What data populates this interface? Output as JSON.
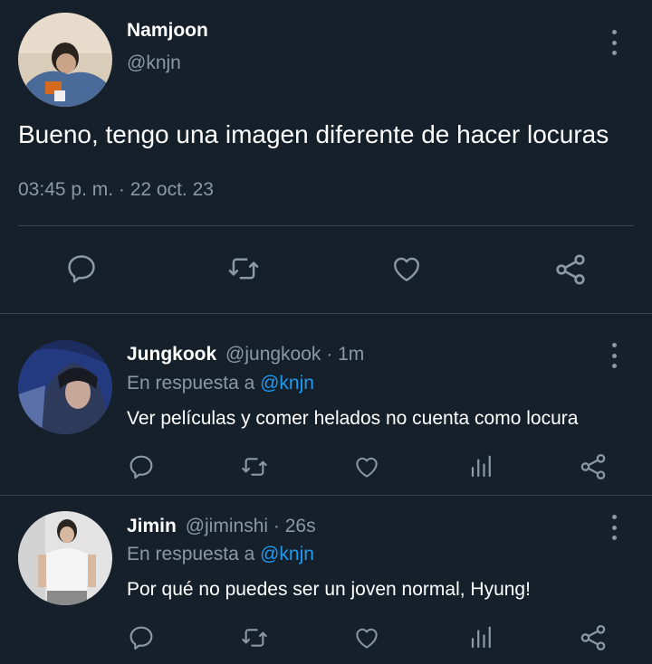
{
  "main_tweet": {
    "author_name": "Namjoon",
    "handle": "@knjn",
    "text": "Bueno, tengo una imagen diferente de hacer locuras",
    "timestamp": "03:45 p. m. · 22 oct. 23",
    "actions": [
      "reply-icon",
      "retweet-icon",
      "like-icon",
      "share-icon"
    ]
  },
  "replies": [
    {
      "author_name": "Jungkook",
      "handle": "@jungkook",
      "time": "· 1m",
      "reply_prefix": "En respuesta a",
      "reply_to": "@knjn",
      "text": "Ver películas y comer helados no cuenta como locura"
    },
    {
      "author_name": "Jimin",
      "handle": "@jiminshi",
      "time": "· 26s",
      "reply_prefix": "En respuesta a",
      "reply_to": "@knjn",
      "text": "Por qué no puedes ser un joven normal, Hyung!"
    }
  ],
  "colors": {
    "background": "#15202b",
    "text": "#ffffff",
    "muted": "#8b98a5",
    "link": "#1d9bf0",
    "divider": "#38444d"
  }
}
